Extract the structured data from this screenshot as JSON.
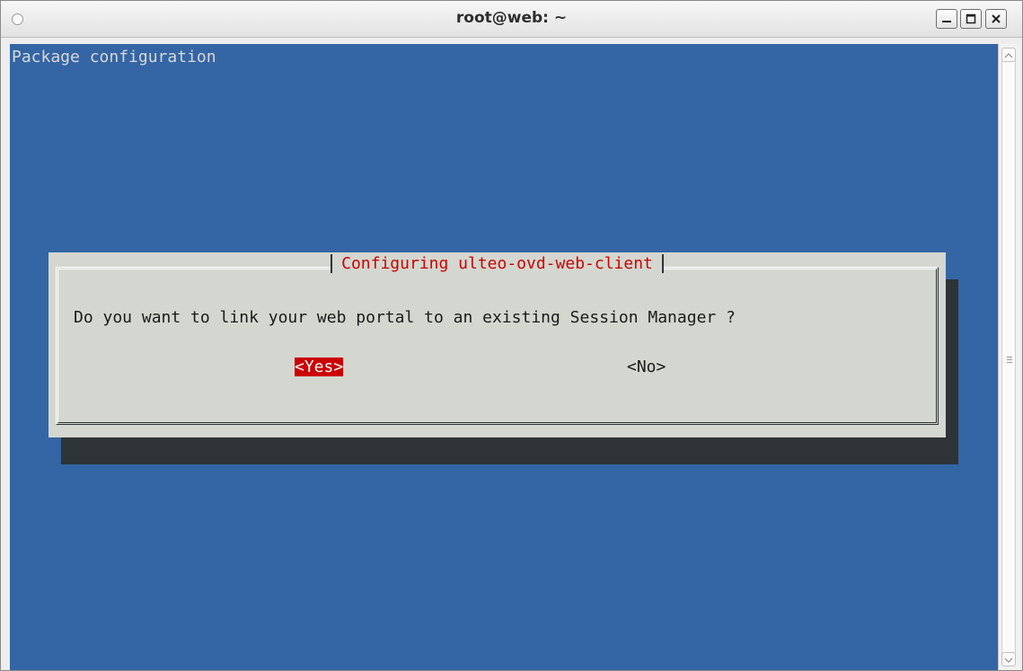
{
  "window": {
    "title": "root@web: ~"
  },
  "terminal": {
    "header": "Package configuration"
  },
  "dialog": {
    "title": "Configuring ulteo-ovd-web-client",
    "question": "Do you want to link your web portal to an existing Session Manager ?",
    "yes_label": "<Yes>",
    "no_label": "<No>",
    "selected": "yes"
  },
  "colors": {
    "terminal_bg": "#3465a4",
    "dialog_bg": "#d3d7cf",
    "accent_red": "#cc0000",
    "shadow": "#2e3436"
  },
  "icons": {
    "window_menu": "circle-icon",
    "minimize": "minimize-icon",
    "maximize": "maximize-icon",
    "close": "close-icon",
    "scroll_up": "chevron-up-icon",
    "scroll_down": "chevron-down-icon"
  }
}
